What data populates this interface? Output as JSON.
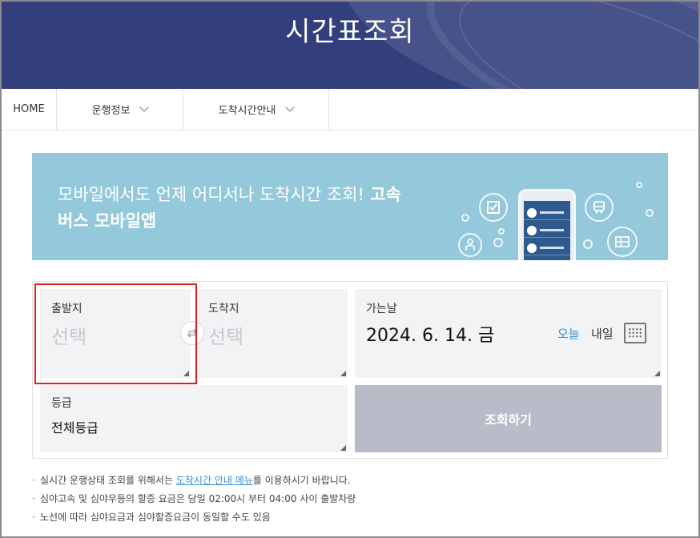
{
  "header": {
    "title": "시간표조회"
  },
  "nav": {
    "home": "HOME",
    "item1": "운행정보",
    "item2": "도착시간안내"
  },
  "banner": {
    "text_normal": "모바일에서도 언제 어디서나 도착시간 조회!",
    "text_bold_1": " 고속",
    "text_bold_2": "버스 모바일앱",
    "icon_bus_label": "BUS"
  },
  "form": {
    "departure": {
      "label": "출발지",
      "value": "선택"
    },
    "arrival": {
      "label": "도착지",
      "value": "선택"
    },
    "date": {
      "label": "가는날",
      "value": "2024. 6. 14. 금",
      "today": "오늘",
      "tomorrow": "내일"
    },
    "grade": {
      "label": "등급",
      "value": "전체등급"
    },
    "search_button": "조회하기",
    "swap_symbol": "⇄"
  },
  "notes": {
    "line1_before": "실시간 운행상태 조회를 위해서는 ",
    "line1_link": "도착시간 안내 메뉴",
    "line1_after": "를 이용하시기 바랍니다.",
    "line2": "심야고속 및 심야우등의 할증 요금은 당일 02:00시 부터 04:00 사이 출발차량",
    "line3": "노선에 따라 심야요금과 심야할증요금이 동일할 수도 있음"
  },
  "colors": {
    "header_bg": "#323f7c",
    "banner_bg": "#94c9db",
    "search_button_bg": "#b7bcc8",
    "link": "#3b8fd0",
    "highlight": "#e02020"
  },
  "icons": [
    "chevron-down-icon",
    "check-icon",
    "bus-icon",
    "person-icon",
    "route-icon",
    "swap-icon",
    "calendar-icon"
  ]
}
